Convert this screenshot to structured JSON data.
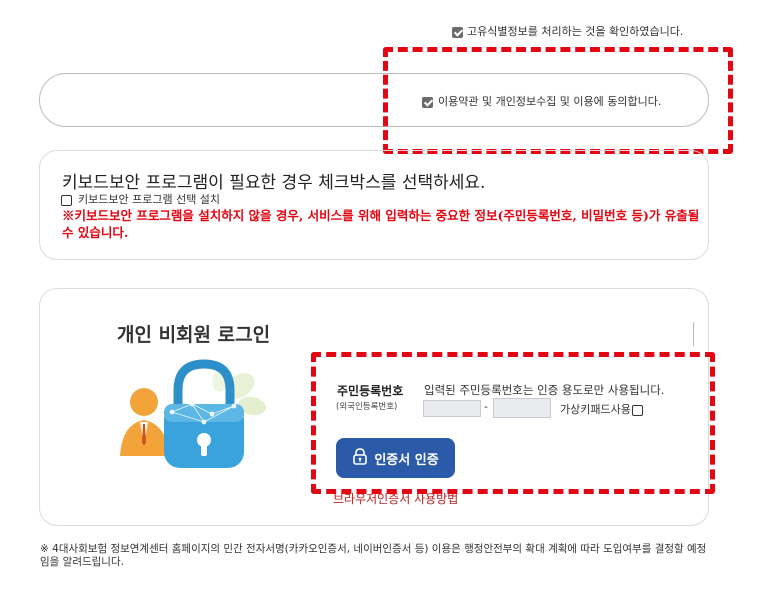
{
  "consent": {
    "unique_id_processing": {
      "label": "고유식별정보를 처리하는 것을 확인하였습니다.",
      "checked": true
    },
    "terms_privacy": {
      "label": "이용약관 및 개인정보수집 및 이용에 동의합니다.",
      "checked": true
    }
  },
  "keyboard_security": {
    "title": "키보드보안 프로그램이 필요한 경우 체크박스를 선택하세요.",
    "checkbox_label": "키보드보안 프로그램 선택 설치",
    "checked": false,
    "warning": "※키보드보안 프로그램을 설치하지 않을 경우, 서비스를 위해 입력하는 중요한 정보(주민등록번호, 비밀번호 등)가 유출될 수 있습니다."
  },
  "login": {
    "title": "개인 비회원 로그인",
    "ssn_label": "주민등록번호",
    "ssn_sublabel": "(외국인등록번호)",
    "ssn_note": "입력된 주민등록번호는 인증 용도로만 사용됩니다.",
    "ssn_separator": "-",
    "ssn_first_value": "",
    "ssn_second_value": "",
    "virtual_keypad_label": "가상키패드사용",
    "virtual_keypad_checked": false,
    "cert_button_label": "인증서 인증",
    "browser_cert_link": "브라우저인증서 사용방법"
  },
  "footnote": "※ 4대사회보험 정보연계센터 홈페이지의 민간 전자서명(카카오인증서, 네이버인증서 등) 이용은 행정안전부의 확대 계획에 따라 도입여부를 결정할 예정임을 알려드립니다.",
  "colors": {
    "highlight_red": "#e30613",
    "cert_button_blue": "#2b5aa8",
    "warning_red": "#e30613"
  },
  "icons": [
    "checkbox-checked-icon",
    "checkbox-unchecked-icon",
    "lock-icon",
    "person-padlock-illustration"
  ]
}
